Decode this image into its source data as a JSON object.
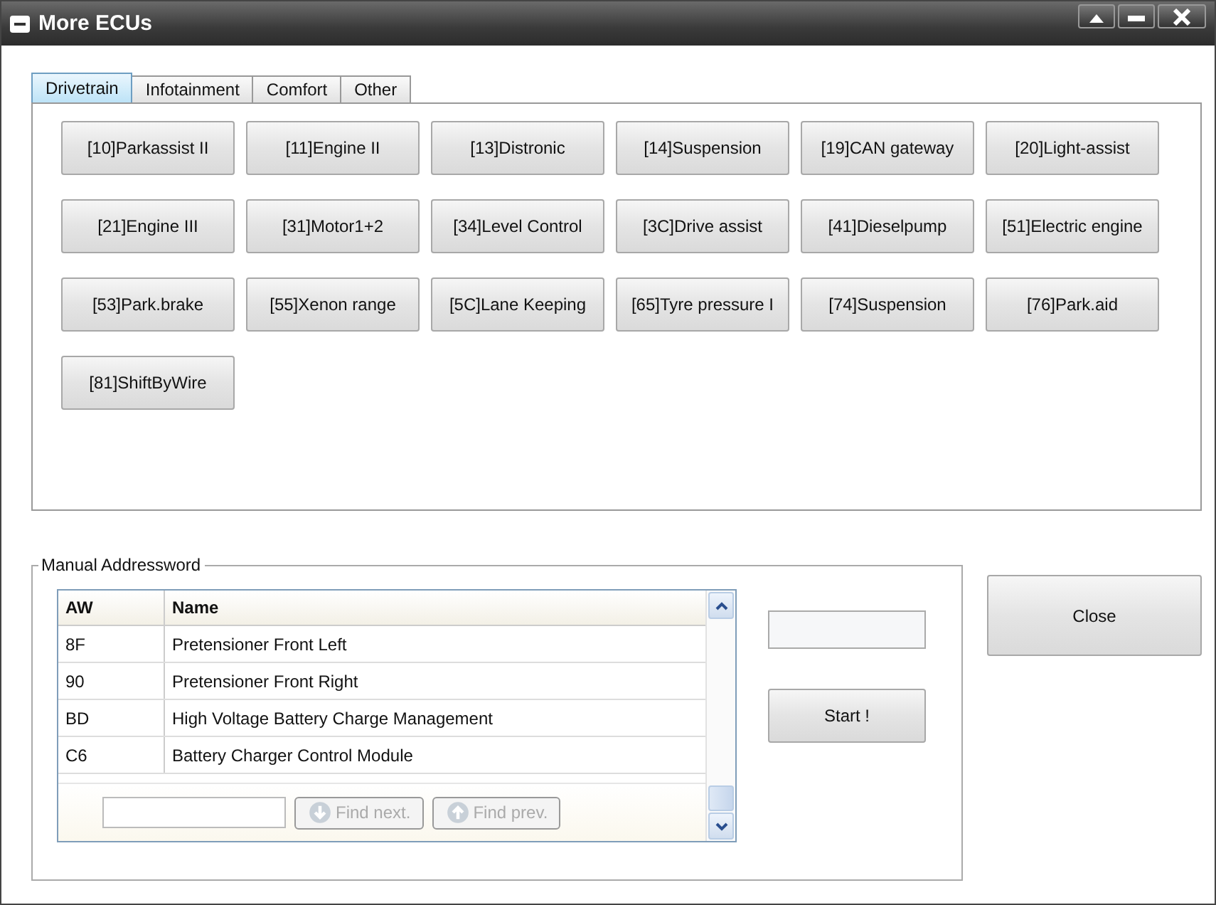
{
  "window": {
    "title": "More ECUs"
  },
  "tabs": [
    {
      "label": "Drivetrain",
      "selected": true
    },
    {
      "label": "Infotainment",
      "selected": false
    },
    {
      "label": "Comfort",
      "selected": false
    },
    {
      "label": "Other",
      "selected": false
    }
  ],
  "ecu_buttons": [
    "[10]Parkassist II",
    "[11]Engine II",
    "[13]Distronic",
    "[14]Suspension",
    "[19]CAN gateway",
    "[20]Light-assist",
    "[21]Engine III",
    "[31]Motor1+2",
    "[34]Level Control",
    "[3C]Drive assist",
    "[41]Dieselpump",
    "[51]Electric engine",
    "[53]Park.brake",
    "[55]Xenon range",
    "[5C]Lane Keeping",
    "[65]Tyre pressure I",
    "[74]Suspension",
    "[76]Park.aid",
    "[81]ShiftByWire"
  ],
  "manual": {
    "title": "Manual Addressword",
    "table": {
      "columns": [
        "AW",
        "Name"
      ],
      "rows": [
        [
          "8F",
          "Pretensioner Front Left"
        ],
        [
          "90",
          "Pretensioner Front Right"
        ],
        [
          "BD",
          "High Voltage Battery Charge Management"
        ],
        [
          "C6",
          "Battery Charger Control Module"
        ]
      ]
    },
    "find_buttons": [
      {
        "label": "Find next.",
        "kind": "down",
        "disabled": true
      },
      {
        "label": "Find prev.",
        "kind": "up",
        "disabled": true
      }
    ],
    "start_button": "Start !"
  },
  "close_button": "Close"
}
